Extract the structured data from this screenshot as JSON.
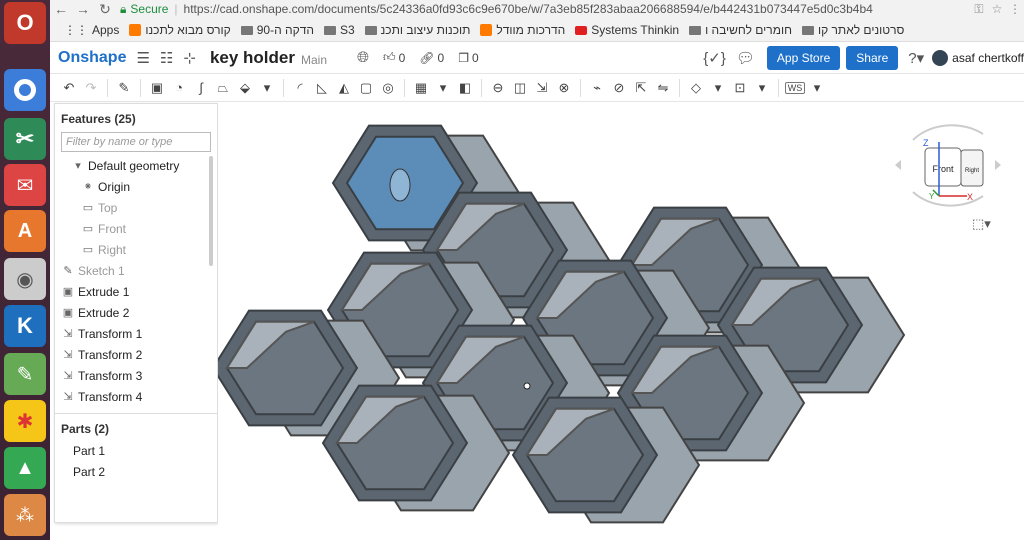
{
  "browser": {
    "secure_label": "Secure",
    "url": "https://cad.onshape.com/documents/5c24336a0fd93c6c9e670be/w/7a3eb85f283abaa206688594/e/b442431b073447e5d0c3b4b4",
    "bookmarks": [
      "Apps",
      "קורס מבוא לתכנו",
      "הדקה ה-90",
      "S3",
      "תוכנות עיצוב ותכנ",
      "הדרכות מוודל",
      "Systems Thinkin",
      "חומרים לחשיבה ו",
      "סרטונים לאתר קו"
    ]
  },
  "header": {
    "logo": "Onshape",
    "doc_name": "key holder",
    "branch": "Main",
    "likes": "0",
    "links": "0",
    "copies": "0",
    "app_store": "App Store",
    "share": "Share",
    "user": "asaf chertkoff"
  },
  "toolbar": {
    "workspace_badge": "WS"
  },
  "features": {
    "title": "Features (25)",
    "filter_placeholder": "Filter by name or type",
    "items": [
      {
        "label": "Default geometry",
        "icon": "chevron-down-icon",
        "dim": false,
        "indent": 1
      },
      {
        "label": "Origin",
        "icon": "origin-icon",
        "dim": false,
        "indent": 2
      },
      {
        "label": "Top",
        "icon": "plane-icon",
        "dim": true,
        "indent": 2
      },
      {
        "label": "Front",
        "icon": "plane-icon",
        "dim": true,
        "indent": 2
      },
      {
        "label": "Right",
        "icon": "plane-icon",
        "dim": true,
        "indent": 2
      },
      {
        "label": "Sketch 1",
        "icon": "sketch-icon",
        "dim": true,
        "indent": 0
      },
      {
        "label": "Extrude 1",
        "icon": "extrude-icon",
        "dim": false,
        "indent": 0
      },
      {
        "label": "Extrude 2",
        "icon": "extrude-icon",
        "dim": false,
        "indent": 0
      },
      {
        "label": "Transform 1",
        "icon": "transform-icon",
        "dim": false,
        "indent": 0
      },
      {
        "label": "Transform 2",
        "icon": "transform-icon",
        "dim": false,
        "indent": 0
      },
      {
        "label": "Transform 3",
        "icon": "transform-icon",
        "dim": false,
        "indent": 0
      },
      {
        "label": "Transform 4",
        "icon": "transform-icon",
        "dim": false,
        "indent": 0
      }
    ]
  },
  "parts": {
    "title": "Parts (2)",
    "items": [
      "Part 1",
      "Part 2"
    ]
  },
  "view_cube": {
    "face_front": "Front",
    "face_right": "Right",
    "axis_z": "Z",
    "axis_y": "Y",
    "axis_x": "X"
  },
  "colors": {
    "brand": "#1e70c8",
    "part_face": "#5c6670",
    "part_side": "#9aa4ad",
    "selected_face": "#5b8db8"
  }
}
